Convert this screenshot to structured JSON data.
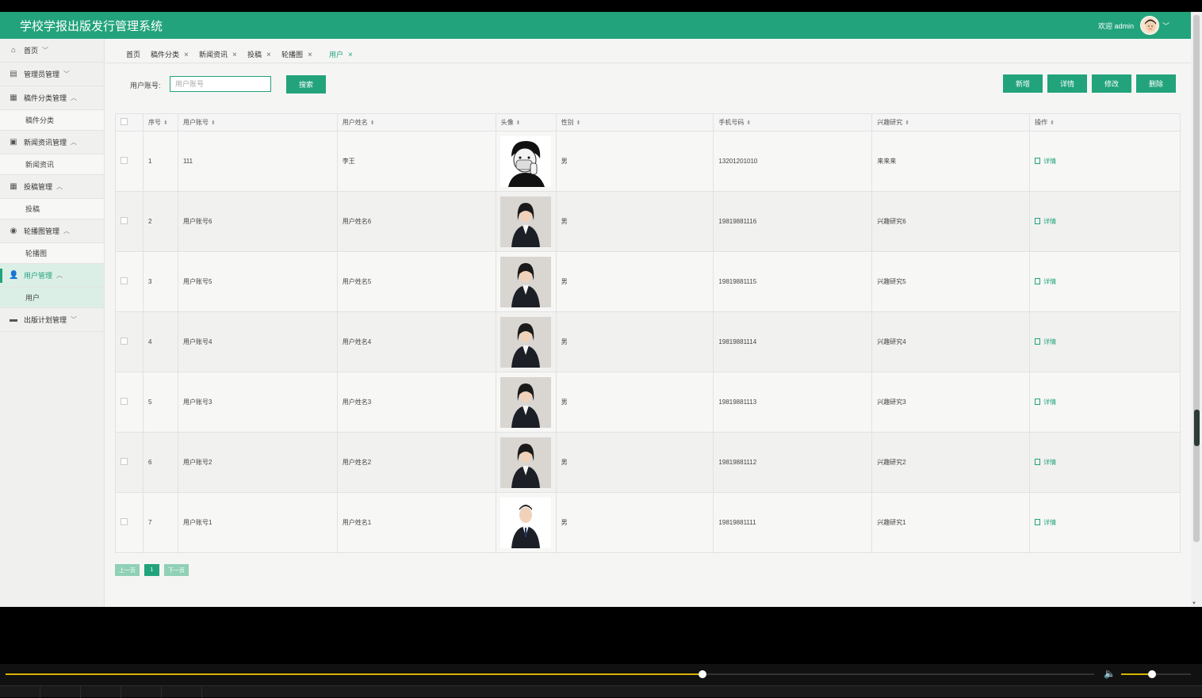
{
  "header": {
    "title": "学校学报出版发行管理系统",
    "welcome": "欢迎 admin"
  },
  "sidebar": {
    "items": [
      {
        "label": "首页",
        "icon": "home-icon",
        "chevron": "﹀"
      },
      {
        "label": "管理员管理",
        "icon": "admin-icon",
        "chevron": "﹀"
      },
      {
        "label": "稿件分类管理",
        "icon": "grid-icon",
        "chevron": "︿",
        "sub": "稿件分类"
      },
      {
        "label": "新闻资讯管理",
        "icon": "image-icon",
        "chevron": "︿",
        "sub": "新闻资讯"
      },
      {
        "label": "投稿管理",
        "icon": "blocks-icon",
        "chevron": "︿",
        "sub": "投稿"
      },
      {
        "label": "轮播图管理",
        "icon": "circle-icon",
        "chevron": "︿",
        "sub": "轮播图"
      },
      {
        "label": "用户管理",
        "icon": "user-icon",
        "chevron": "︿",
        "sub": "用户",
        "active": true
      },
      {
        "label": "出版计划管理",
        "icon": "folder-icon",
        "chevron": "﹀"
      }
    ]
  },
  "tabs": [
    {
      "label": "首页",
      "closable": false
    },
    {
      "label": "稿件分类",
      "closable": true
    },
    {
      "label": "新闻资讯",
      "closable": true
    },
    {
      "label": "投稿",
      "closable": true
    },
    {
      "label": "轮播图",
      "closable": true
    },
    {
      "label": "用户",
      "closable": true,
      "active": true
    }
  ],
  "search": {
    "label": "用户账号:",
    "placeholder": "用户账号",
    "button": "搜索"
  },
  "actions": {
    "add": "新增",
    "detail": "详情",
    "edit": "修改",
    "delete": "删除"
  },
  "table": {
    "headers": [
      "序号",
      "用户账号",
      "用户姓名",
      "头像",
      "性别",
      "手机号码",
      "兴趣研究",
      "操作"
    ],
    "detail_label": "详情",
    "rows": [
      {
        "no": "1",
        "account": "111",
        "name": "李王",
        "avatar": "cartoon-boy-masked",
        "gender": "男",
        "phone": "13201201010",
        "interest": "来来来"
      },
      {
        "no": "2",
        "account": "用户账号6",
        "name": "用户姓名6",
        "avatar": "woman-suit-photo",
        "gender": "男",
        "phone": "19819881116",
        "interest": "兴趣研究6"
      },
      {
        "no": "3",
        "account": "用户账号5",
        "name": "用户姓名5",
        "avatar": "woman-suit-photo",
        "gender": "男",
        "phone": "19819881115",
        "interest": "兴趣研究5"
      },
      {
        "no": "4",
        "account": "用户账号4",
        "name": "用户姓名4",
        "avatar": "woman-suit-photo",
        "gender": "男",
        "phone": "19819881114",
        "interest": "兴趣研究4"
      },
      {
        "no": "5",
        "account": "用户账号3",
        "name": "用户姓名3",
        "avatar": "woman-suit-photo",
        "gender": "男",
        "phone": "19819881113",
        "interest": "兴趣研究3"
      },
      {
        "no": "6",
        "account": "用户账号2",
        "name": "用户姓名2",
        "avatar": "woman-suit-photo",
        "gender": "男",
        "phone": "19819881112",
        "interest": "兴趣研究2"
      },
      {
        "no": "7",
        "account": "用户账号1",
        "name": "用户姓名1",
        "avatar": "man-suit-photo",
        "gender": "男",
        "phone": "19819881111",
        "interest": "兴趣研究1"
      }
    ]
  },
  "pagination": {
    "prev": "上一页",
    "current": "1",
    "next": "下一页"
  },
  "player": {
    "progress": 0.64,
    "volume": 0.44
  },
  "colors": {
    "primary": "#22a37b",
    "background": "#f5f5f4",
    "sidebar": "#f0f0ef"
  }
}
